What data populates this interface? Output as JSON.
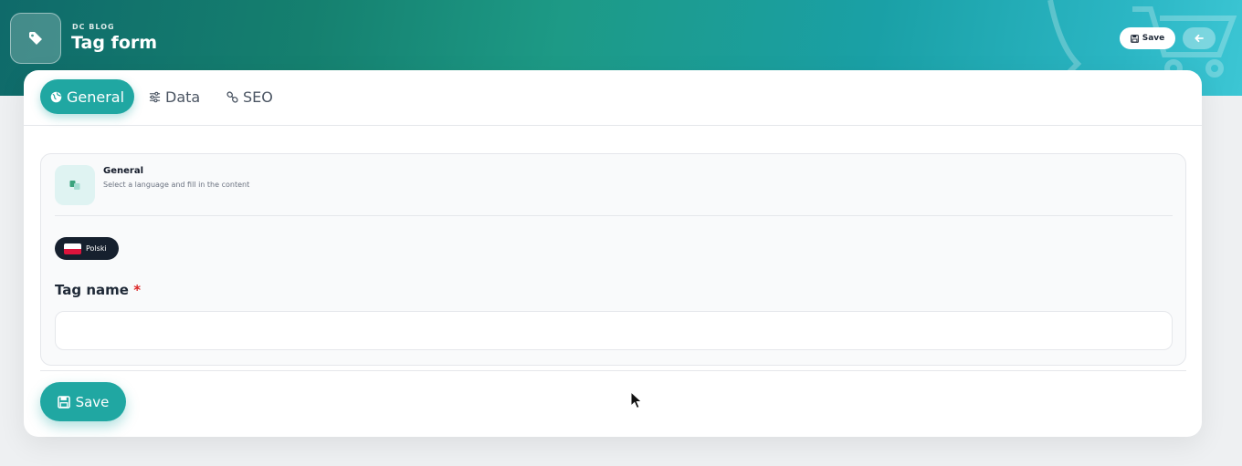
{
  "header": {
    "breadcrumb": "DC BLOG",
    "title": "Tag form",
    "save_label": "Save",
    "app_icon": "tag-icon",
    "back_icon": "arrow-left-icon"
  },
  "tabs": [
    {
      "label": "General",
      "icon": "globe-icon",
      "active": true
    },
    {
      "label": "Data",
      "icon": "sliders-icon",
      "active": false
    },
    {
      "label": "SEO",
      "icon": "link-icon",
      "active": false
    }
  ],
  "section": {
    "title": "General",
    "subtitle": "Select a language and fill in the content",
    "icon": "language-icon"
  },
  "language": {
    "label": "Polski",
    "flag": "pl-flag-icon"
  },
  "field": {
    "label": "Tag name",
    "required_mark": "*",
    "value": "",
    "placeholder": ""
  },
  "footer": {
    "save_label": "Save"
  },
  "colors": {
    "accent": "#20a7a2",
    "dark_pill": "#16202e",
    "required": "#dc2626"
  }
}
